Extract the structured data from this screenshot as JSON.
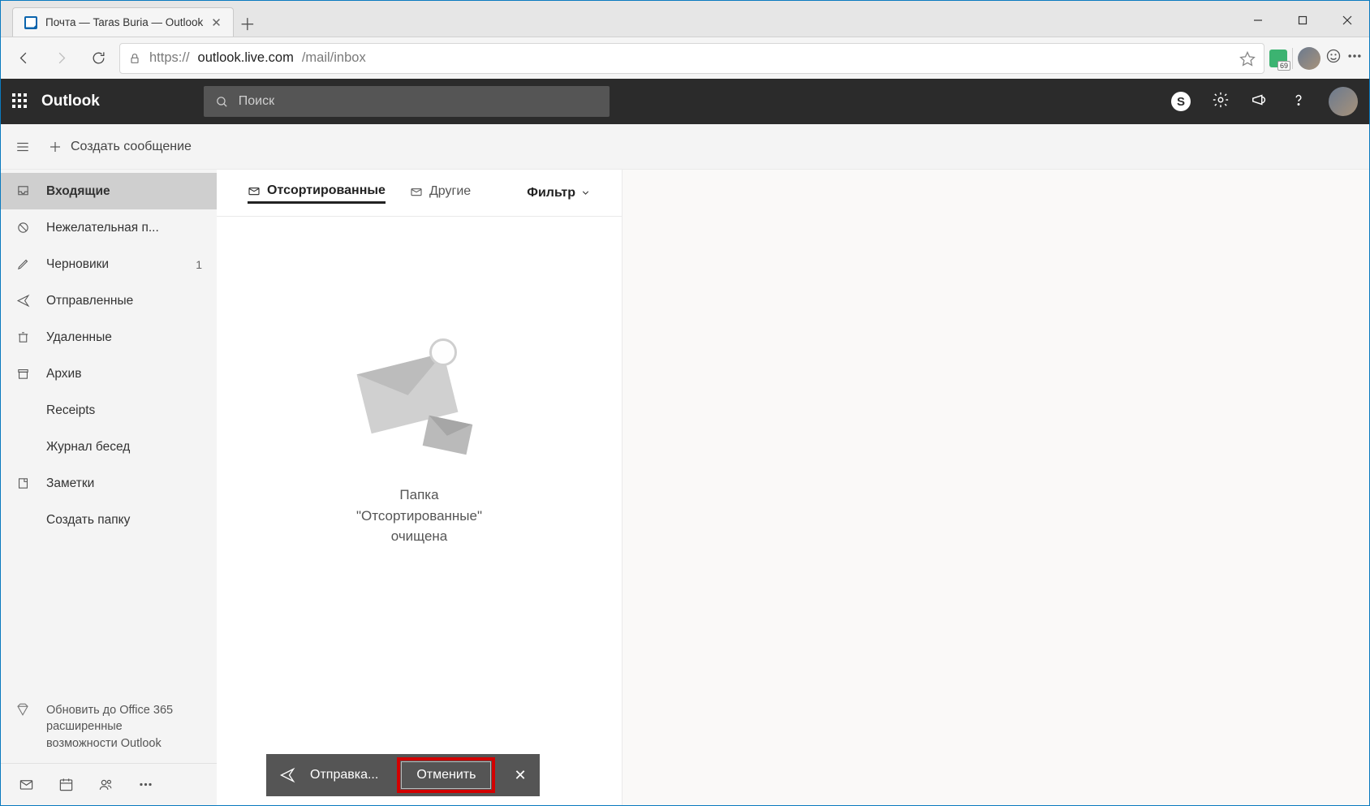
{
  "browser": {
    "tab_title": "Почта — Taras Buria — Outlook",
    "url_scheme": "https://",
    "url_host": "outlook.live.com",
    "url_path": "/mail/inbox",
    "ext_badge": "69"
  },
  "header": {
    "brand": "Outlook",
    "search_placeholder": "Поиск"
  },
  "cmdbar": {
    "new_message": "Создать сообщение"
  },
  "sidebar": {
    "folders": [
      {
        "icon": "inbox",
        "label": "Входящие",
        "badge": "",
        "selected": true
      },
      {
        "icon": "block",
        "label": "Нежелательная п...",
        "badge": ""
      },
      {
        "icon": "pencil",
        "label": "Черновики",
        "badge": "1"
      },
      {
        "icon": "send",
        "label": "Отправленные",
        "badge": ""
      },
      {
        "icon": "trash",
        "label": "Удаленные",
        "badge": ""
      },
      {
        "icon": "archive",
        "label": "Архив",
        "badge": ""
      },
      {
        "icon": "",
        "label": "Receipts",
        "badge": ""
      },
      {
        "icon": "",
        "label": "Журнал бесед",
        "badge": ""
      },
      {
        "icon": "note",
        "label": "Заметки",
        "badge": ""
      },
      {
        "icon": "",
        "label": "Создать папку",
        "badge": ""
      }
    ],
    "upsell": "Обновить до Office 365 расширенные возможности Outlook"
  },
  "list": {
    "tab_focused": "Отсортированные",
    "tab_other": "Другие",
    "filter": "Фильтр",
    "empty_line1": "Папка",
    "empty_line2": "\"Отсортированные\"",
    "empty_line3": "очищена"
  },
  "toast": {
    "sending": "Отправка...",
    "undo": "Отменить"
  }
}
